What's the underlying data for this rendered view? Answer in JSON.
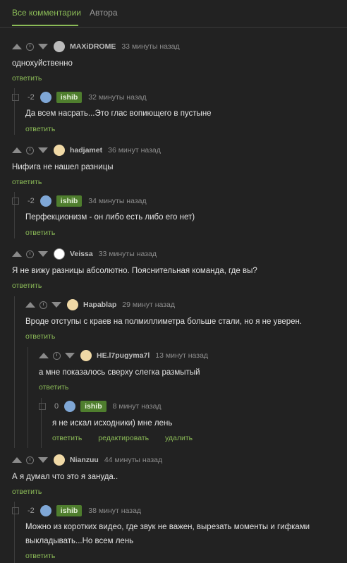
{
  "tabs": {
    "all": "Все комментарии",
    "author": "Автора"
  },
  "colors": {
    "accent": "#8bbb57",
    "badge": "#4f7e2e"
  },
  "icons": {
    "upvote": "triangle-up",
    "downvote": "triangle-down",
    "time": "clock",
    "collapse": "square"
  },
  "reply": "ответить",
  "edit": "редактировать",
  "delete": "удалить",
  "comments": [
    {
      "user": "MAXiDROME",
      "time": "33 минуты назад",
      "text": "однохуйственно"
    },
    {
      "score": "-2",
      "user": "ishib",
      "time": "32 минуты назад",
      "text": "Да всем насрать...Это глас вопиющего в пустыне"
    },
    {
      "user": "hadjamet",
      "time": "36 минут назад",
      "text": "Нифига не нашел разницы"
    },
    {
      "score": "-2",
      "user": "ishib",
      "time": "34 минуты назад",
      "text": "Перфекционизм - он либо есть либо его нет)"
    },
    {
      "user": "Veissa",
      "time": "33 минуты назад",
      "text": "Я не вижу разницы абсолютно. Пояснительная команда, где вы?"
    },
    {
      "user": "Hapablap",
      "time": "29 минут назад",
      "text": "Вроде отступы с краев на полмиллиметра больше стали, но я не уверен."
    },
    {
      "user": "HE.l7pugyma7l",
      "time": "13 минут назад",
      "text": "а мне показалось сверху слегка размытый"
    },
    {
      "score": "0",
      "user": "ishib",
      "time": "8 минут назад",
      "text": "я не искал исходники) мне лень"
    },
    {
      "user": "Nianzuu",
      "time": "44 минуты назад",
      "text": "А я думал что это я зануда.."
    },
    {
      "score": "-2",
      "user": "ishib",
      "time": "38 минут назад",
      "text1": "Можно из коротких видео, где звук не важен, вырезать моменты и гифками",
      "text2": "выкладывать...Но всем лень"
    }
  ]
}
